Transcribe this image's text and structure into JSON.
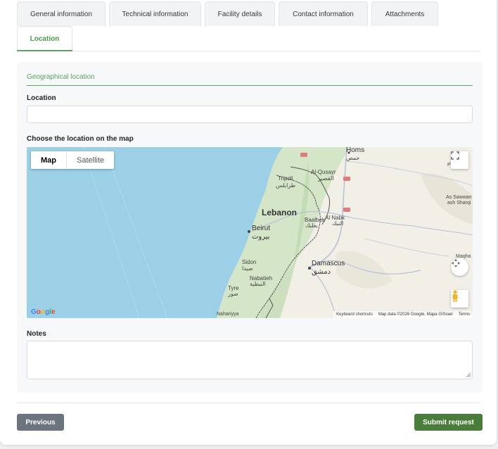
{
  "tabs": [
    {
      "label": "General information"
    },
    {
      "label": "Technical information"
    },
    {
      "label": "Facility details"
    },
    {
      "label": "Contact information"
    },
    {
      "label": "Attachments"
    },
    {
      "label": "Location",
      "active": true
    }
  ],
  "section": {
    "title": "Geographical location"
  },
  "location_field": {
    "label": "Location",
    "value": "",
    "placeholder": ""
  },
  "map_section": {
    "label": "Choose the location on the map",
    "map_types": {
      "map": "Map",
      "satellite": "Satellite",
      "selected": "Map"
    },
    "places": {
      "homs": "Homs",
      "homs_ar": "حمص",
      "tripoli": "Tripoli",
      "tripoli_ar": "طرابلس",
      "alqusayr": "Al-Qusayr",
      "alqusayr_ar": "القصير",
      "lebanon": "Lebanon",
      "beirut": "Beirut",
      "beirut_ar": "بيروت",
      "baalbek": "Baalbek",
      "baalbek_ar": "بعلبك",
      "alnabk": "Al Nabk",
      "alnabk_ar": "النبك",
      "sidon": "Sidon",
      "sidon_ar": "صيدا",
      "damascus": "Damascus",
      "damascus_ar": "دمشق",
      "nabatieh": "Nabatieh",
      "nabatieh_ar": "النبطية",
      "tyre": "Tyre",
      "tyre_ar": "صور",
      "nahariyya": "Nahariyya",
      "assawwan": "As Sawwan",
      "ash_sharqi": "ash Sharqi",
      "maqha": "Maqha",
      "p_edge": "P"
    },
    "attribution": {
      "keyboard": "Keyboard shortcuts",
      "map_data": "Map data ©2026 Google, Mapa GISrael",
      "terms": "Terms"
    },
    "google": "Google"
  },
  "notes_field": {
    "label": "Notes",
    "value": ""
  },
  "buttons": {
    "previous": "Previous",
    "submit": "Submit request"
  },
  "colors": {
    "accent": "#5aa65c",
    "submit_bg": "#4a7d3c",
    "previous_bg": "#6c757d",
    "water": "#9cd0e6",
    "land": "#f1efe6"
  }
}
